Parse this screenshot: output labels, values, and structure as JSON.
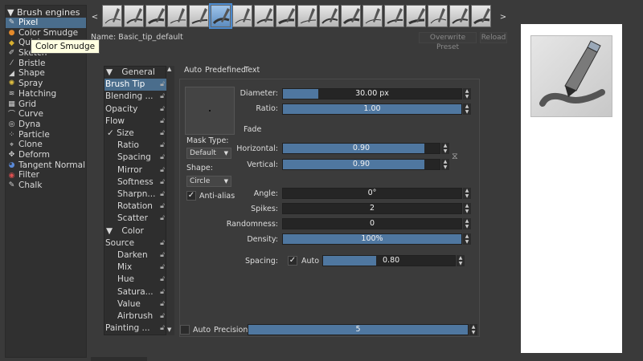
{
  "engines": {
    "header": "Brush engines",
    "items": [
      {
        "label": "Pixel",
        "icon": "pixel-icon",
        "selected": true
      },
      {
        "label": "Color Smudge",
        "icon": "smudge-icon"
      },
      {
        "label": "Quick",
        "icon": "quick-icon"
      },
      {
        "label": "Sketch",
        "icon": "sketch-icon"
      },
      {
        "label": "Bristle",
        "icon": "bristle-icon"
      },
      {
        "label": "Shape",
        "icon": "shape-icon"
      },
      {
        "label": "Spray",
        "icon": "spray-icon"
      },
      {
        "label": "Hatching",
        "icon": "hatching-icon"
      },
      {
        "label": "Grid",
        "icon": "grid-icon"
      },
      {
        "label": "Curve",
        "icon": "curve-icon"
      },
      {
        "label": "Dyna",
        "icon": "dyna-icon"
      },
      {
        "label": "Particle",
        "icon": "particle-icon"
      },
      {
        "label": "Clone",
        "icon": "clone-icon"
      },
      {
        "label": "Deform",
        "icon": "deform-icon"
      },
      {
        "label": "Tangent Normal",
        "icon": "tangent-normal-icon"
      },
      {
        "label": "Filter",
        "icon": "filter-icon"
      },
      {
        "label": "Chalk",
        "icon": "chalk-icon"
      }
    ],
    "tooltip": "Color Smudge"
  },
  "preset_strip": {
    "prev": "<",
    "next": ">",
    "count": 18,
    "selected_index": 5
  },
  "name_bar": {
    "label": "Name: Basic_tip_default",
    "overwrite_label": "Overwrite Preset",
    "reload_label": "Reload"
  },
  "categories": {
    "items": [
      {
        "label": "General",
        "type": "group"
      },
      {
        "label": "Brush Tip",
        "selected": true,
        "lock": true
      },
      {
        "label": "Blending ...",
        "lock": true
      },
      {
        "label": "Opacity",
        "lock": true
      },
      {
        "label": "Flow",
        "lock": true
      },
      {
        "label": "Size",
        "checked": true,
        "indent": true,
        "lock": true
      },
      {
        "label": "Ratio",
        "indent": true,
        "lock": true
      },
      {
        "label": "Spacing",
        "indent": true,
        "lock": true
      },
      {
        "label": "Mirror",
        "indent": true,
        "lock": true
      },
      {
        "label": "Softness",
        "indent": true,
        "lock": true
      },
      {
        "label": "Sharpn...",
        "indent": true,
        "lock": true
      },
      {
        "label": "Rotation",
        "indent": true,
        "lock": true
      },
      {
        "label": "Scatter",
        "indent": true,
        "lock": true
      },
      {
        "label": "Color",
        "type": "group"
      },
      {
        "label": "Source",
        "lock": true
      },
      {
        "label": "Darken",
        "indent": true,
        "lock": true
      },
      {
        "label": "Mix",
        "indent": true,
        "lock": true
      },
      {
        "label": "Hue",
        "indent": true,
        "lock": true
      },
      {
        "label": "Satura...",
        "indent": true,
        "lock": true
      },
      {
        "label": "Value",
        "indent": true,
        "lock": true
      },
      {
        "label": "Airbrush",
        "indent": true,
        "lock": true
      },
      {
        "label": "Painting ...",
        "lock": true
      }
    ]
  },
  "tabs": [
    "Auto",
    "Predefined",
    "Text"
  ],
  "tip": {
    "mask_type_label": "Mask Type:",
    "mask_type_value": "Default",
    "shape_label": "Shape:",
    "shape_value": "Circle",
    "antialias_label": "Anti-alias",
    "antialias_checked": true,
    "fade_label": "Fade"
  },
  "params": {
    "diameter": {
      "label": "Diameter:",
      "value": "30.00 px",
      "fill": 0.2
    },
    "ratio": {
      "label": "Ratio:",
      "value": "1.00",
      "fill": 1.0
    },
    "horizontal": {
      "label": "Horizontal:",
      "value": "0.90",
      "fill": 0.9
    },
    "vertical": {
      "label": "Vertical:",
      "value": "0.90",
      "fill": 0.9
    },
    "angle": {
      "label": "Angle:",
      "value": "0°",
      "fill": 0
    },
    "spikes": {
      "label": "Spikes:",
      "value": "2",
      "fill": 0
    },
    "randomness": {
      "label": "Randomness:",
      "value": "0",
      "fill": 0
    },
    "density": {
      "label": "Density:",
      "value": "100%",
      "fill": 1.0
    },
    "spacing": {
      "label": "Spacing:",
      "auto_label": "Auto",
      "auto_checked": true,
      "value": "0.80",
      "fill": 0.4
    }
  },
  "precision": {
    "auto_label": "Auto",
    "auto_checked": false,
    "label": "Precision:",
    "value": "5",
    "fill": 1.0
  }
}
